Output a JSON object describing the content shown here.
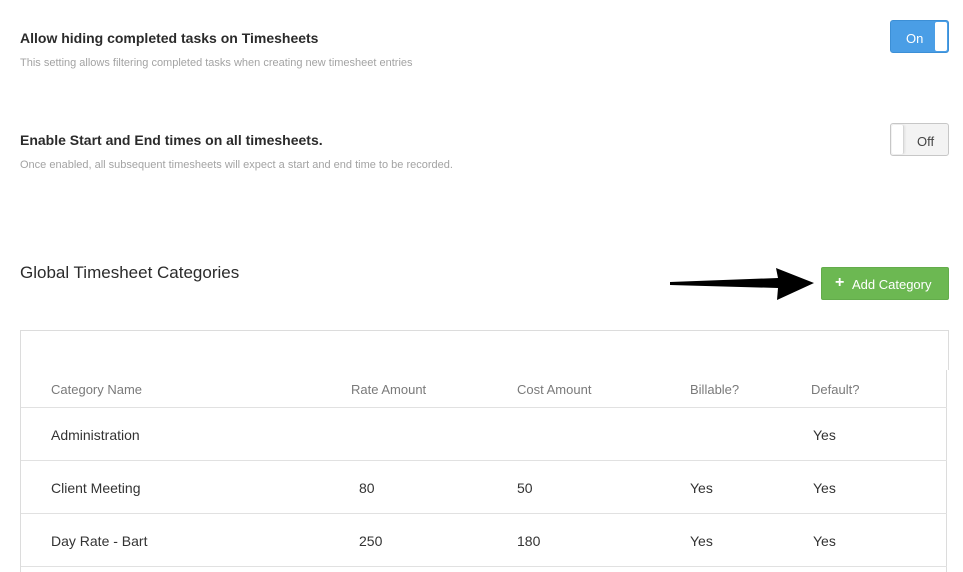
{
  "settings": [
    {
      "title": "Allow hiding completed tasks on Timesheets",
      "description": "This setting allows filtering completed tasks when creating new timesheet entries",
      "toggle_label": "On"
    },
    {
      "title": "Enable Start and End times on all timesheets.",
      "description": "Once enabled, all subsequent timesheets will expect a start and end time to be recorded.",
      "toggle_label": "Off"
    }
  ],
  "categories_section": {
    "title": "Global Timesheet Categories",
    "add_button_label": "Add Category",
    "add_button_icon": "plus-icon",
    "columns": [
      "Category Name",
      "Rate Amount",
      "Cost Amount",
      "Billable?",
      "Default?"
    ],
    "rows": [
      [
        "Administration",
        "",
        "",
        "",
        "Yes"
      ],
      [
        "Client Meeting",
        "80",
        "50",
        "Yes",
        "Yes"
      ],
      [
        "Day Rate - Bart",
        "250",
        "180",
        "Yes",
        "Yes"
      ]
    ]
  },
  "colors": {
    "toggle_on": "#4a9ee6",
    "add_button": "#6cb852"
  }
}
